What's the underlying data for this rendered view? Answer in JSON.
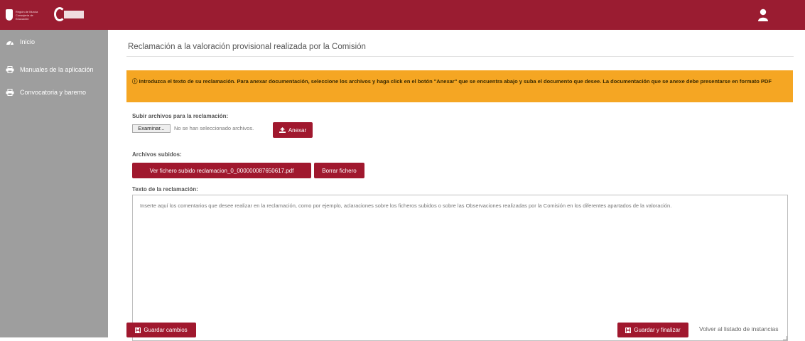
{
  "header": {
    "logo1_text": "Región de Murcia",
    "logo1_sub": "Consejería de Educación",
    "logo2_text": "",
    "user_icon": "user-icon"
  },
  "sidebar": {
    "items": [
      {
        "label": "Inicio",
        "icon": "dashboard-icon"
      },
      {
        "label": "Manuales de la aplicación",
        "icon": "printer-icon"
      },
      {
        "label": "Convocatoria y baremo",
        "icon": "printer-icon"
      }
    ]
  },
  "main": {
    "title": "Reclamación a la valoración provisional realizada por la Comisión",
    "alert": "Introduzca el texto de su reclamación. Para anexar documentación, seleccione los archivos y haga click en el botón \"Anexar\" que se encuentra abajo y suba el documento que desee. La documentación que se anexe debe presentarse en formato PDF",
    "upload_label": "Subir archivos para la reclamación:",
    "browse_button": "Examinar...",
    "file_status": "No se han seleccionado archivos.",
    "attach_button": "Anexar",
    "uploaded_label": "Archivos subidos:",
    "view_file_button": "Ver fichero subido reclamacion_0_000000087650617.pdf",
    "delete_file_button": "Borrar fichero",
    "text_label": "Texto de la reclamación:",
    "textarea_placeholder": "Inserte aquí los comentarios que desee realizar en la reclamación, como por ejemplo, aclaraciones sobre los ficheros subidos o sobre las Observaciones realizadas por la Comisión en los diferentes apartados de la valoración.",
    "save_button": "Guardar cambios",
    "save_finish_button": "Guardar y finalizar",
    "back_link": "Volver al listado de instancias"
  },
  "colors": {
    "header": "#9a1c31",
    "sidebar": "#9e9e9e",
    "alert": "#f5a623",
    "button": "#a0182e"
  }
}
